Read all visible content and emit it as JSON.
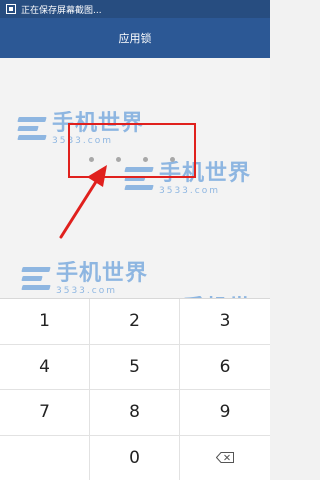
{
  "status_bar": {
    "notification_text": "正在保存屏幕截图...",
    "icon": "screenshot-icon"
  },
  "app_bar": {
    "title": "应用锁"
  },
  "pin": {
    "entered_count": 4,
    "highlight_color": "#e0201d"
  },
  "watermark": {
    "brand": "手机世界",
    "number": "3533.com",
    "color": "#3d86d4"
  },
  "keypad": {
    "keys": [
      "1",
      "2",
      "3",
      "4",
      "5",
      "6",
      "7",
      "8",
      "9",
      "",
      "0",
      "backspace"
    ],
    "backspace_icon": "backspace-icon"
  },
  "colors": {
    "status_bar": "#274d80",
    "app_bar": "#2c5895",
    "content_bg": "#f3f3f3",
    "arrow": "#e0201d"
  }
}
